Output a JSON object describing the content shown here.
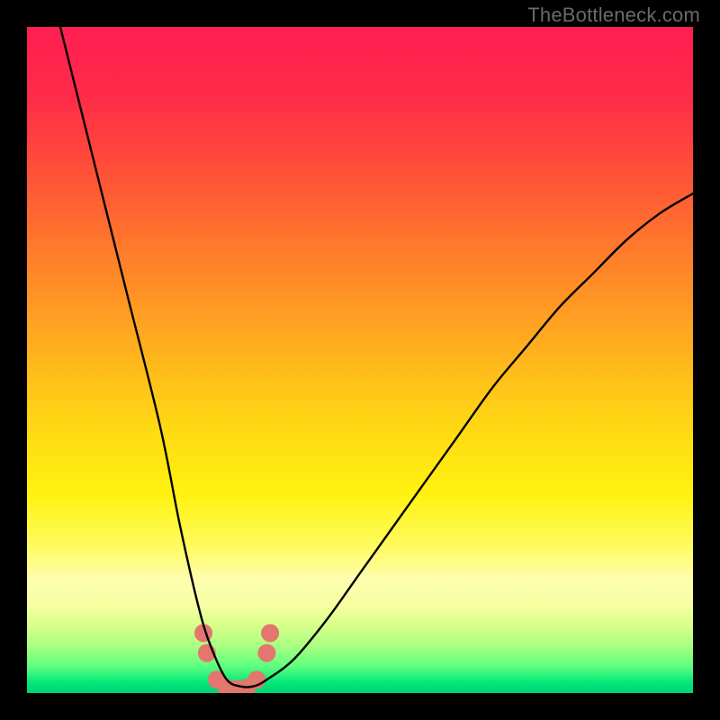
{
  "watermark": "TheBottleneck.com",
  "gradient": {
    "stops": [
      {
        "offset": 0.0,
        "color": "#ff1f52"
      },
      {
        "offset": 0.1,
        "color": "#ff2a49"
      },
      {
        "offset": 0.2,
        "color": "#ff4a3a"
      },
      {
        "offset": 0.3,
        "color": "#ff6e2f"
      },
      {
        "offset": 0.4,
        "color": "#ff9225"
      },
      {
        "offset": 0.5,
        "color": "#ffb61c"
      },
      {
        "offset": 0.6,
        "color": "#ffd814"
      },
      {
        "offset": 0.7,
        "color": "#fff20f"
      },
      {
        "offset": 0.78,
        "color": "#fffb60"
      },
      {
        "offset": 0.83,
        "color": "#fffdb0"
      },
      {
        "offset": 0.87,
        "color": "#f4ffa0"
      },
      {
        "offset": 0.9,
        "color": "#d6ff8a"
      },
      {
        "offset": 0.93,
        "color": "#a8ff82"
      },
      {
        "offset": 0.96,
        "color": "#5eff7e"
      },
      {
        "offset": 0.985,
        "color": "#00e77a"
      },
      {
        "offset": 1.0,
        "color": "#00d474"
      }
    ]
  },
  "chart_data": {
    "type": "line",
    "title": "",
    "xlabel": "",
    "ylabel": "",
    "xlim": [
      0,
      100
    ],
    "ylim": [
      0,
      100
    ],
    "series": [
      {
        "name": "bottleneck-curve",
        "x": [
          5,
          10,
          15,
          20,
          23,
          26,
          28,
          30,
          32,
          34,
          36,
          40,
          45,
          50,
          55,
          60,
          65,
          70,
          75,
          80,
          85,
          90,
          95,
          100
        ],
        "y": [
          100,
          80,
          60,
          40,
          25,
          12,
          6,
          2,
          1,
          1,
          2,
          5,
          11,
          18,
          25,
          32,
          39,
          46,
          52,
          58,
          63,
          68,
          72,
          75
        ]
      }
    ],
    "markers": {
      "name": "dip-dots",
      "x": [
        26.5,
        27.0,
        28.5,
        30.0,
        31.5,
        33.0,
        34.5,
        36.0,
        36.5
      ],
      "y": [
        9.0,
        6.0,
        2.0,
        0.8,
        0.6,
        0.8,
        2.0,
        6.0,
        9.0
      ],
      "color": "#e3766e",
      "radius": 10
    }
  }
}
